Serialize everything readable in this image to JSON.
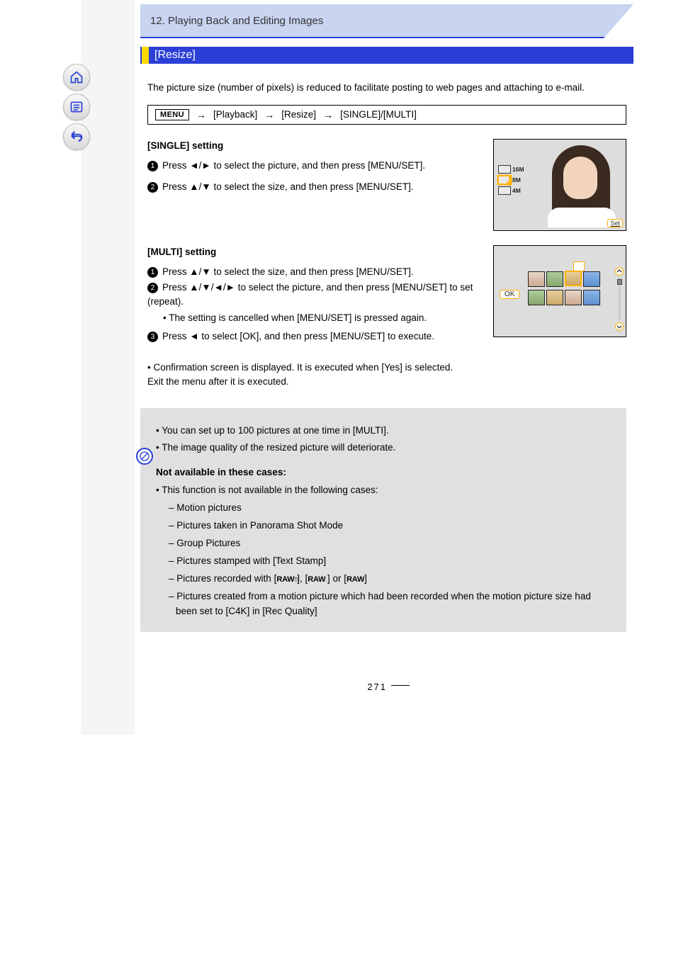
{
  "header": {
    "page_number_top": "12.",
    "breadcrumb": "Playing Back and Editing Images"
  },
  "section": {
    "title": "[Resize]"
  },
  "intro": "The picture size (number of pixels) is reduced to facilitate posting to web pages and attaching to e-mail.",
  "menu_path": {
    "menu_button": "MENU",
    "step1": "[Playback]",
    "step2": "[Resize]",
    "step3": "[SINGLE]/[MULTI]"
  },
  "single": {
    "heading": "[SINGLE] setting",
    "step1": "Press ◄/► to select the picture, and then press [MENU/SET].",
    "step2": "Press ▲/▼ to select the size, and then press [MENU/SET].",
    "figure": {
      "sizes": [
        "16M",
        "8M",
        "4M"
      ],
      "selected_index": 1,
      "set_button": "Set"
    }
  },
  "multi": {
    "heading": "[MULTI] setting",
    "step1": "Press ▲/▼ to select the size, and then press [MENU/SET].",
    "step2": "Press ▲/▼/◄/► to select the picture, and then press [MENU/SET] to set (repeat).",
    "step2_sub": "• The setting is cancelled when [MENU/SET] is pressed again.",
    "step3": "Press ◄ to select [OK], and then press [MENU/SET] to execute.",
    "figure": {
      "ok_button": "OK"
    }
  },
  "footnote": "• Confirmation screen is displayed. It is executed when [Yes] is selected.\nExit the menu after it is executed.",
  "notes": {
    "n1": "• You can set up to 100 pictures at one time in [MULTI].",
    "n2": "• The image quality of the resized picture will deteriorate.",
    "navail_heading": "Not available in these cases:",
    "navail_intro": "• This function is not available in the following cases:",
    "items": [
      "Motion pictures",
      "Pictures taken in Panorama Shot Mode",
      "Group Pictures",
      "Pictures stamped with [Text Stamp]",
      "Pictures recorded with [RAW···], [RAW·.·.] or [RAW]",
      "Pictures created from a motion picture which had been recorded when the motion picture size had been set to [C4K] in [Rec Quality]"
    ]
  },
  "page_number_bottom": "271"
}
